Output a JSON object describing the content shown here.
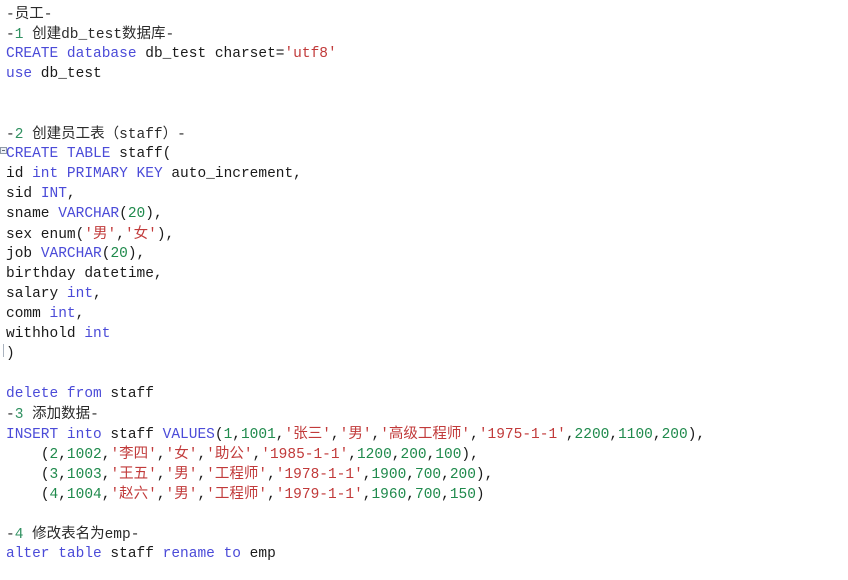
{
  "editor": {
    "language": "SQL",
    "colors": {
      "keyword": "#4b4bd8",
      "number": "#1f8a4c",
      "string": "#c13a3a",
      "comment": "#2b2b2b",
      "plain": "#1a1a1a",
      "background": "#ffffff"
    }
  },
  "lines": [
    {
      "id": 1,
      "type": "comment",
      "text": "-员工-"
    },
    {
      "id": 2,
      "type": "comment",
      "text": "-1 创建db_test数据库-",
      "parts": [
        {
          "t": "-",
          "c": "cmt"
        },
        {
          "t": "1",
          "c": "cmt-num"
        },
        {
          "t": " 创建db_test数据库-",
          "c": "cmt"
        }
      ]
    },
    {
      "id": 3,
      "type": "code",
      "text": "CREATE database db_test charset='utf8'",
      "parts": [
        {
          "t": "CREATE",
          "c": "kw"
        },
        {
          "t": " ",
          "c": "plain"
        },
        {
          "t": "database",
          "c": "kw"
        },
        {
          "t": " db_test charset=",
          "c": "plain"
        },
        {
          "t": "'utf8'",
          "c": "str"
        }
      ]
    },
    {
      "id": 4,
      "type": "code",
      "text": "use db_test",
      "parts": [
        {
          "t": "use",
          "c": "kw"
        },
        {
          "t": " db_test",
          "c": "plain"
        }
      ]
    },
    {
      "id": 5,
      "type": "blank",
      "text": ""
    },
    {
      "id": 6,
      "type": "blank",
      "text": ""
    },
    {
      "id": 7,
      "type": "comment",
      "text": "-2 创建员工表（staff）-",
      "parts": [
        {
          "t": "-",
          "c": "cmt"
        },
        {
          "t": "2",
          "c": "cmt-num"
        },
        {
          "t": " 创建员工表（staff）-",
          "c": "cmt"
        }
      ]
    },
    {
      "id": 8,
      "type": "code",
      "fold": "box",
      "text": "CREATE TABLE staff(",
      "parts": [
        {
          "t": "CREATE",
          "c": "kw"
        },
        {
          "t": " ",
          "c": "plain"
        },
        {
          "t": "TABLE",
          "c": "kw"
        },
        {
          "t": " staff(",
          "c": "plain"
        }
      ]
    },
    {
      "id": 9,
      "type": "code",
      "text": "id int PRIMARY KEY auto_increment,",
      "parts": [
        {
          "t": "id ",
          "c": "plain"
        },
        {
          "t": "int",
          "c": "kw"
        },
        {
          "t": " ",
          "c": "plain"
        },
        {
          "t": "PRIMARY",
          "c": "kw"
        },
        {
          "t": " ",
          "c": "plain"
        },
        {
          "t": "KEY",
          "c": "kw"
        },
        {
          "t": " auto_increment,",
          "c": "plain"
        }
      ]
    },
    {
      "id": 10,
      "type": "code",
      "text": "sid INT,",
      "parts": [
        {
          "t": "sid ",
          "c": "plain"
        },
        {
          "t": "INT",
          "c": "kw"
        },
        {
          "t": ",",
          "c": "plain"
        }
      ]
    },
    {
      "id": 11,
      "type": "code",
      "text": "sname VARCHAR(20),",
      "parts": [
        {
          "t": "sname ",
          "c": "plain"
        },
        {
          "t": "VARCHAR",
          "c": "kw"
        },
        {
          "t": "(",
          "c": "plain"
        },
        {
          "t": "20",
          "c": "num"
        },
        {
          "t": "),",
          "c": "plain"
        }
      ]
    },
    {
      "id": 12,
      "type": "code",
      "text": "sex enum('男','女'),",
      "parts": [
        {
          "t": "sex enum(",
          "c": "plain"
        },
        {
          "t": "'男'",
          "c": "str"
        },
        {
          "t": ",",
          "c": "plain"
        },
        {
          "t": "'女'",
          "c": "str"
        },
        {
          "t": "),",
          "c": "plain"
        }
      ]
    },
    {
      "id": 13,
      "type": "code",
      "text": "job VARCHAR(20),",
      "parts": [
        {
          "t": "job ",
          "c": "plain"
        },
        {
          "t": "VARCHAR",
          "c": "kw"
        },
        {
          "t": "(",
          "c": "plain"
        },
        {
          "t": "20",
          "c": "num"
        },
        {
          "t": "),",
          "c": "plain"
        }
      ]
    },
    {
      "id": 14,
      "type": "code",
      "text": "birthday datetime,",
      "parts": [
        {
          "t": "birthday datetime,",
          "c": "plain"
        }
      ]
    },
    {
      "id": 15,
      "type": "code",
      "text": "salary int,",
      "parts": [
        {
          "t": "salary ",
          "c": "plain"
        },
        {
          "t": "int",
          "c": "kw"
        },
        {
          "t": ",",
          "c": "plain"
        }
      ]
    },
    {
      "id": 16,
      "type": "code",
      "text": "comm int,",
      "parts": [
        {
          "t": "comm ",
          "c": "plain"
        },
        {
          "t": "int",
          "c": "kw"
        },
        {
          "t": ",",
          "c": "plain"
        }
      ]
    },
    {
      "id": 17,
      "type": "code",
      "text": "withhold int",
      "parts": [
        {
          "t": "withhold ",
          "c": "plain"
        },
        {
          "t": "int",
          "c": "kw"
        }
      ]
    },
    {
      "id": 18,
      "type": "code",
      "fold": "line",
      "text": ")",
      "parts": [
        {
          "t": ")",
          "c": "plain"
        }
      ]
    },
    {
      "id": 19,
      "type": "blank",
      "text": ""
    },
    {
      "id": 20,
      "type": "code",
      "text": "delete from staff",
      "parts": [
        {
          "t": "delete",
          "c": "kw"
        },
        {
          "t": " ",
          "c": "plain"
        },
        {
          "t": "from",
          "c": "kw"
        },
        {
          "t": " staff",
          "c": "plain"
        }
      ]
    },
    {
      "id": 21,
      "type": "comment",
      "text": "-3 添加数据-",
      "parts": [
        {
          "t": "-",
          "c": "cmt"
        },
        {
          "t": "3",
          "c": "cmt-num"
        },
        {
          "t": " 添加数据-",
          "c": "cmt"
        }
      ]
    },
    {
      "id": 22,
      "type": "code",
      "text": "INSERT into staff VALUES(1,1001,'张三','男','高级工程师','1975-1-1',2200,1100,200),",
      "parts": [
        {
          "t": "INSERT",
          "c": "kw"
        },
        {
          "t": " ",
          "c": "plain"
        },
        {
          "t": "into",
          "c": "kw"
        },
        {
          "t": " staff ",
          "c": "plain"
        },
        {
          "t": "VALUES",
          "c": "kw"
        },
        {
          "t": "(",
          "c": "plain"
        },
        {
          "t": "1",
          "c": "num"
        },
        {
          "t": ",",
          "c": "plain"
        },
        {
          "t": "1001",
          "c": "num"
        },
        {
          "t": ",",
          "c": "plain"
        },
        {
          "t": "'张三'",
          "c": "str"
        },
        {
          "t": ",",
          "c": "plain"
        },
        {
          "t": "'男'",
          "c": "str"
        },
        {
          "t": ",",
          "c": "plain"
        },
        {
          "t": "'高级工程师'",
          "c": "str"
        },
        {
          "t": ",",
          "c": "plain"
        },
        {
          "t": "'1975-1-1'",
          "c": "str"
        },
        {
          "t": ",",
          "c": "plain"
        },
        {
          "t": "2200",
          "c": "num"
        },
        {
          "t": ",",
          "c": "plain"
        },
        {
          "t": "1100",
          "c": "num"
        },
        {
          "t": ",",
          "c": "plain"
        },
        {
          "t": "200",
          "c": "num"
        },
        {
          "t": "),",
          "c": "plain"
        }
      ]
    },
    {
      "id": 23,
      "type": "code",
      "indent": 4,
      "text": "(2,1002,'李四','女','助公','1985-1-1',1200,200,100),",
      "parts": [
        {
          "t": "(",
          "c": "plain"
        },
        {
          "t": "2",
          "c": "num"
        },
        {
          "t": ",",
          "c": "plain"
        },
        {
          "t": "1002",
          "c": "num"
        },
        {
          "t": ",",
          "c": "plain"
        },
        {
          "t": "'李四'",
          "c": "str"
        },
        {
          "t": ",",
          "c": "plain"
        },
        {
          "t": "'女'",
          "c": "str"
        },
        {
          "t": ",",
          "c": "plain"
        },
        {
          "t": "'助公'",
          "c": "str"
        },
        {
          "t": ",",
          "c": "plain"
        },
        {
          "t": "'1985-1-1'",
          "c": "str"
        },
        {
          "t": ",",
          "c": "plain"
        },
        {
          "t": "1200",
          "c": "num"
        },
        {
          "t": ",",
          "c": "plain"
        },
        {
          "t": "200",
          "c": "num"
        },
        {
          "t": ",",
          "c": "plain"
        },
        {
          "t": "100",
          "c": "num"
        },
        {
          "t": "),",
          "c": "plain"
        }
      ]
    },
    {
      "id": 24,
      "type": "code",
      "indent": 4,
      "text": "(3,1003,'王五','男','工程师','1978-1-1',1900,700,200),",
      "parts": [
        {
          "t": "(",
          "c": "plain"
        },
        {
          "t": "3",
          "c": "num"
        },
        {
          "t": ",",
          "c": "plain"
        },
        {
          "t": "1003",
          "c": "num"
        },
        {
          "t": ",",
          "c": "plain"
        },
        {
          "t": "'王五'",
          "c": "str"
        },
        {
          "t": ",",
          "c": "plain"
        },
        {
          "t": "'男'",
          "c": "str"
        },
        {
          "t": ",",
          "c": "plain"
        },
        {
          "t": "'工程师'",
          "c": "str"
        },
        {
          "t": ",",
          "c": "plain"
        },
        {
          "t": "'1978-1-1'",
          "c": "str"
        },
        {
          "t": ",",
          "c": "plain"
        },
        {
          "t": "1900",
          "c": "num"
        },
        {
          "t": ",",
          "c": "plain"
        },
        {
          "t": "700",
          "c": "num"
        },
        {
          "t": ",",
          "c": "plain"
        },
        {
          "t": "200",
          "c": "num"
        },
        {
          "t": "),",
          "c": "plain"
        }
      ]
    },
    {
      "id": 25,
      "type": "code",
      "indent": 4,
      "text": "(4,1004,'赵六','男','工程师','1979-1-1',1960,700,150)",
      "parts": [
        {
          "t": "(",
          "c": "plain"
        },
        {
          "t": "4",
          "c": "num"
        },
        {
          "t": ",",
          "c": "plain"
        },
        {
          "t": "1004",
          "c": "num"
        },
        {
          "t": ",",
          "c": "plain"
        },
        {
          "t": "'赵六'",
          "c": "str"
        },
        {
          "t": ",",
          "c": "plain"
        },
        {
          "t": "'男'",
          "c": "str"
        },
        {
          "t": ",",
          "c": "plain"
        },
        {
          "t": "'工程师'",
          "c": "str"
        },
        {
          "t": ",",
          "c": "plain"
        },
        {
          "t": "'1979-1-1'",
          "c": "str"
        },
        {
          "t": ",",
          "c": "plain"
        },
        {
          "t": "1960",
          "c": "num"
        },
        {
          "t": ",",
          "c": "plain"
        },
        {
          "t": "700",
          "c": "num"
        },
        {
          "t": ",",
          "c": "plain"
        },
        {
          "t": "150",
          "c": "num"
        },
        {
          "t": ")",
          "c": "plain"
        }
      ]
    },
    {
      "id": 26,
      "type": "blank",
      "text": ""
    },
    {
      "id": 27,
      "type": "comment",
      "text": "-4 修改表名为emp-",
      "parts": [
        {
          "t": "-",
          "c": "cmt"
        },
        {
          "t": "4",
          "c": "cmt-num"
        },
        {
          "t": " 修改表名为emp-",
          "c": "cmt"
        }
      ]
    },
    {
      "id": 28,
      "type": "code",
      "text": "alter table staff rename to emp",
      "parts": [
        {
          "t": "alter",
          "c": "kw"
        },
        {
          "t": " ",
          "c": "plain"
        },
        {
          "t": "table",
          "c": "kw"
        },
        {
          "t": " staff ",
          "c": "plain"
        },
        {
          "t": "rename",
          "c": "kw"
        },
        {
          "t": " ",
          "c": "plain"
        },
        {
          "t": "to",
          "c": "kw"
        },
        {
          "t": " emp",
          "c": "plain"
        }
      ]
    }
  ]
}
